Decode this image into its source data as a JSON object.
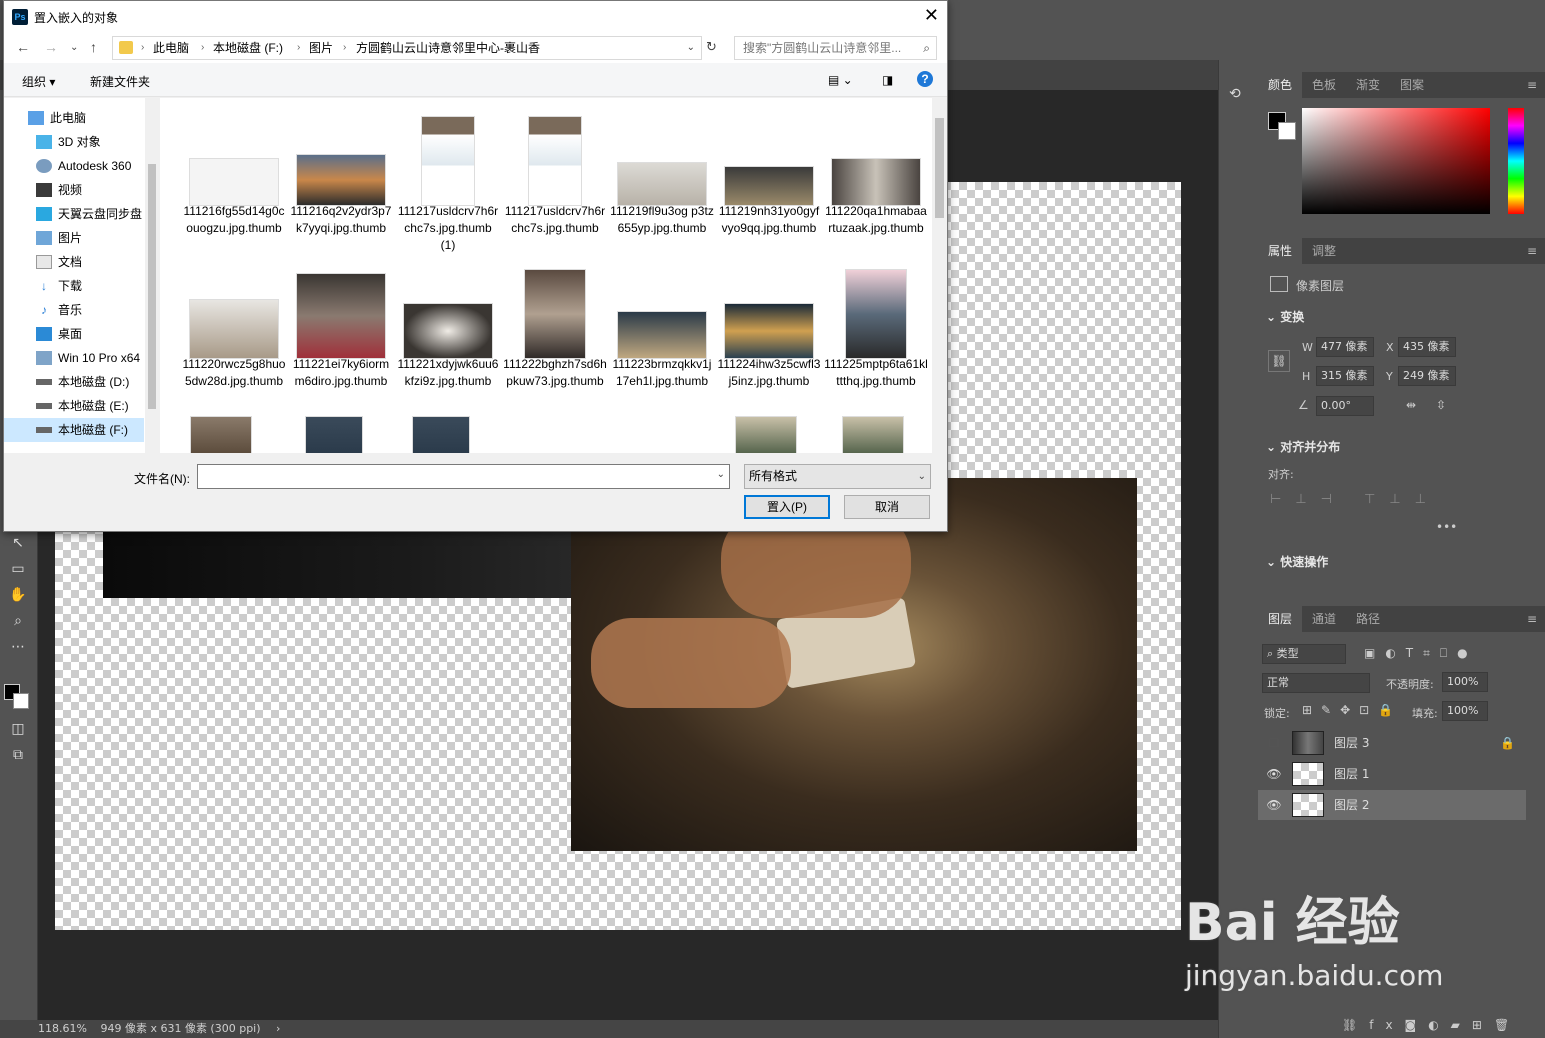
{
  "dialog": {
    "title": "置入嵌入的对象",
    "breadcrumb": [
      "此电脑",
      "本地磁盘 (F:)",
      "图片",
      "方圆鹤山云山诗意邻里中心-裹山香"
    ],
    "search_placeholder": "搜索\"方圆鹤山云山诗意邻里...",
    "organize_label": "组织 ▾",
    "new_folder_label": "新建文件夹",
    "nav_items": [
      {
        "label": "此电脑"
      },
      {
        "label": "3D 对象"
      },
      {
        "label": "Autodesk 360"
      },
      {
        "label": "视频"
      },
      {
        "label": "天翼云盘同步盘"
      },
      {
        "label": "图片"
      },
      {
        "label": "文档"
      },
      {
        "label": "下载"
      },
      {
        "label": "音乐"
      },
      {
        "label": "桌面"
      },
      {
        "label": "Win 10 Pro x64"
      },
      {
        "label": "本地磁盘 (D:)"
      },
      {
        "label": "本地磁盘 (E:)"
      },
      {
        "label": "本地磁盘 (F:)"
      }
    ],
    "files": [
      {
        "name": "111216fg55d14g0couogzu.jpg.thumb"
      },
      {
        "name": "111216q2v2ydr3p7k7yyqi.jpg.thumb"
      },
      {
        "name": "111217usldcrv7h6rchc7s.jpg.thumb (1)"
      },
      {
        "name": "111217usldcrv7h6rchc7s.jpg.thumb"
      },
      {
        "name": "111219fl9u3og p3tz655yp.jpg.thumb"
      },
      {
        "name": "111219nh31yo0gyfvyo9qq.jpg.thumb"
      },
      {
        "name": "111220qa1hmabaartuzaak.jpg.thumb"
      },
      {
        "name": "111220rwcz5g8huo5dw28d.jpg.thumb"
      },
      {
        "name": "111221ei7ky6iormm6diro.jpg.thumb"
      },
      {
        "name": "111221xdyjwk6uu6kfzi9z.jpg.thumb"
      },
      {
        "name": "111222bghzh7sd6hpkuw73.jpg.thumb"
      },
      {
        "name": "111223brmzqkkv1j17eh1l.jpg.thumb"
      },
      {
        "name": "111224ihw3z5cwfl3j5inz.jpg.thumb"
      },
      {
        "name": "111225mptp6ta61klttthq.jpg.thumb"
      }
    ],
    "filename_label": "文件名(N):",
    "filename_value": "",
    "filetype_value": "所有格式",
    "place_button": "置入(P)",
    "cancel_button": "取消"
  },
  "panels": {
    "color_tabs": [
      "颜色",
      "色板",
      "渐变",
      "图案"
    ],
    "props_tabs": [
      "属性",
      "调整"
    ],
    "props_type": "像素图层",
    "transform_title": "变换",
    "w_label": "W",
    "w_value": "477 像素",
    "h_label": "H",
    "h_value": "315 像素",
    "x_label": "X",
    "x_value": "435 像素",
    "y_label": "Y",
    "y_value": "249 像素",
    "angle_value": "0.00°",
    "align_title": "对齐并分布",
    "align_label": "对齐:",
    "quick_title": "快速操作",
    "layers_tabs": [
      "图层",
      "通道",
      "路径"
    ],
    "filter_label": "类型",
    "blend_mode": "正常",
    "opacity_label": "不透明度:",
    "opacity_value": "100%",
    "lock_label": "锁定:",
    "fill_label": "填充:",
    "fill_value": "100%",
    "layers": [
      {
        "name": "图层 3",
        "visible": false,
        "locked": true,
        "selected": false
      },
      {
        "name": "图层 1",
        "visible": true,
        "locked": false,
        "selected": false
      },
      {
        "name": "图层 2",
        "visible": true,
        "locked": false,
        "selected": true
      }
    ]
  },
  "status": {
    "zoom": "118.61%",
    "doc_info": "949 像素 x 631 像素 (300 ppi)"
  },
  "watermark": {
    "brand": "Bai 经验",
    "url": "jingyan.baidu.com"
  }
}
